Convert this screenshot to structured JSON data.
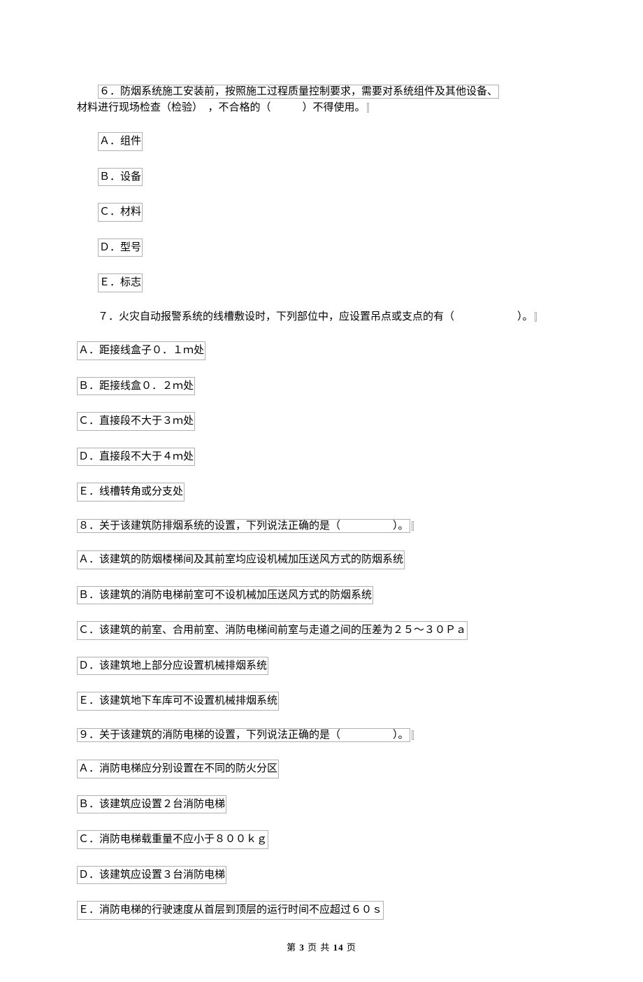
{
  "q6": {
    "stem_part1": "６．防烟系统施工安装前，按照施工过程质量控制要求，需要对系统组件及其他设备、",
    "stem_part2": "材料进行现场检查（检验）　，不合格的（　　　）不得使用。",
    "options": {
      "a": "Ａ．组件",
      "b": "Ｂ．设备",
      "c": "Ｃ．材料",
      "d": "Ｄ．型号",
      "e": "Ｅ．标志"
    }
  },
  "q7": {
    "stem": "７．火灾自动报警系统的线槽敷设时，下列部位中，应设置吊点或支点的有（　　　　　　）。",
    "options": {
      "a": "Ａ．距接线盒子０．１ｍ处",
      "b": "Ｂ．距接线盒０．２ｍ处",
      "c": "Ｃ．直接段不大于３ｍ处",
      "d": "Ｄ．直接段不大于４ｍ处",
      "e": "Ｅ．线槽转角或分支处"
    }
  },
  "q8": {
    "stem": "８．关于该建筑防排烟系统的设置，下列说法正确的是（　　　　　）。",
    "options": {
      "a": "Ａ．该建筑的防烟楼梯间及其前室均应设机械加压送风方式的防烟系统",
      "b": "Ｂ．该建筑的消防电梯前室可不设机械加压送风方式的防烟系统",
      "c": "Ｃ．该建筑的前室、合用前室、消防电梯间前室与走道之间的压差为２５～３０Ｐａ",
      "d": "Ｄ．该建筑地上部分应设置机械排烟系统",
      "e": "Ｅ．该建筑地下车库可不设置机械排烟系统"
    }
  },
  "q9": {
    "stem": "９．关于该建筑的消防电梯的设置，下列说法正确的是（　　　　　）。",
    "options": {
      "a": "Ａ．消防电梯应分别设置在不同的防火分区",
      "b": "Ｂ．该建筑应设置２台消防电梯",
      "c": "Ｃ．消防电梯载重量不应小于８００ｋｇ",
      "d": "Ｄ．该建筑应设置３台消防电梯",
      "e": "Ｅ．消防电梯的行驶速度从首层到顶层的运行时间不应超过６０ｓ"
    }
  },
  "footer": {
    "prefix": "第",
    "current": "3",
    "mid": "页 共",
    "total": "14",
    "suffix": "页"
  }
}
